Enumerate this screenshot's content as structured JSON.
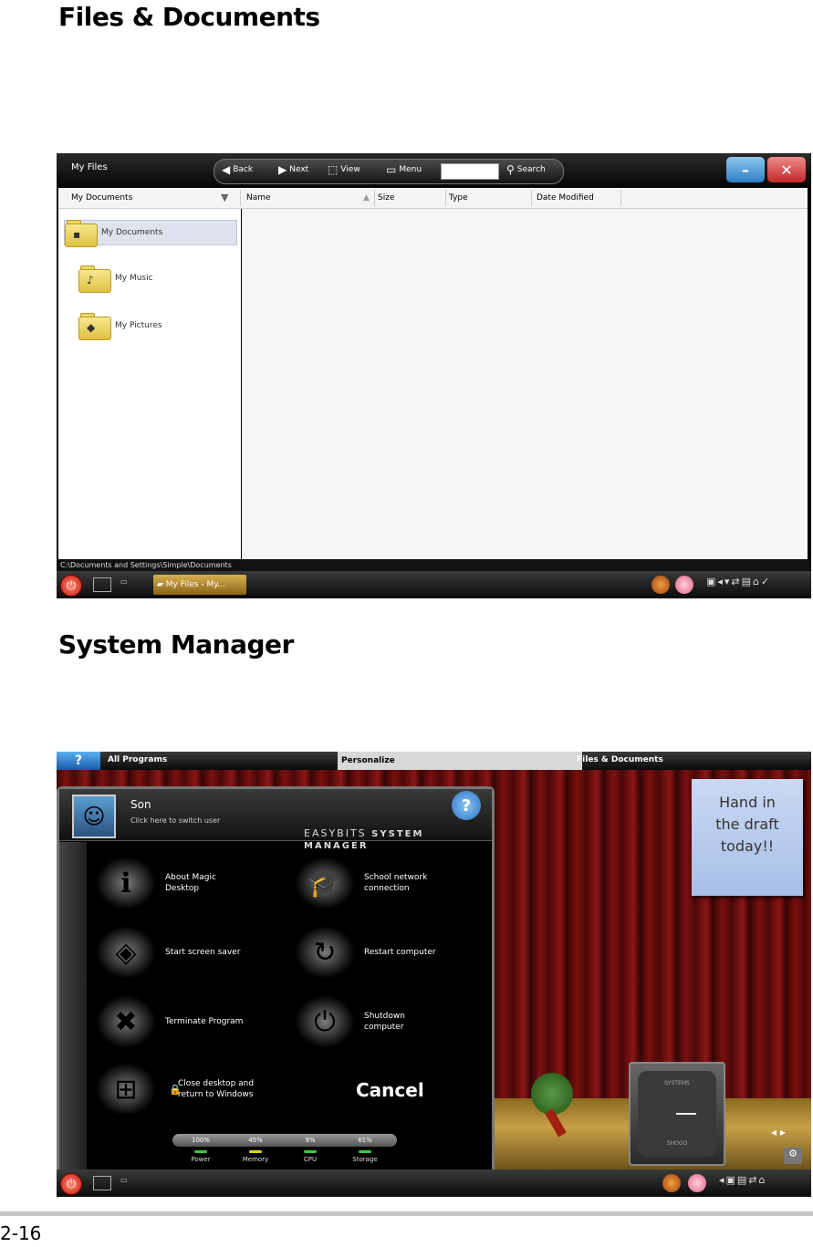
{
  "headings": {
    "files": "Files & Documents",
    "system": "System Manager"
  },
  "page_number": "2-16",
  "files_window": {
    "title": "My Files",
    "toolbar": {
      "back": "Back",
      "next": "Next",
      "view": "View",
      "menu": "Menu",
      "search": "Search",
      "search_value": ""
    },
    "window_buttons": {
      "minimize": "–",
      "close": "✕"
    },
    "location_dropdown": "My Documents",
    "columns": [
      "Name",
      "Size",
      "Type",
      "Date Modified"
    ],
    "folders": [
      {
        "label": "My Documents",
        "icon": "folder-documents-icon",
        "selected": true
      },
      {
        "label": "My Music",
        "icon": "folder-music-icon",
        "selected": false
      },
      {
        "label": "My Pictures",
        "icon": "folder-pictures-icon",
        "selected": false
      }
    ],
    "status": "C:\\Documents and Settings\\Simple\\Documents",
    "taskbar_item": "My Files - My..."
  },
  "system_manager": {
    "top_tabs": [
      "All Programs",
      "Personalize",
      "Files & Documents"
    ],
    "help_label": "?",
    "user": {
      "name": "Son",
      "hint": "Click here to switch user"
    },
    "brand": {
      "name": "EASYBITS",
      "product": "SYSTEM MANAGER"
    },
    "options": [
      {
        "label": "About Magic Desktop",
        "icon": "about-icon"
      },
      {
        "label": "School network connection",
        "icon": "graduation-cap-icon"
      },
      {
        "label": "Start screen saver",
        "icon": "screen-saver-icon"
      },
      {
        "label": "Restart computer",
        "icon": "restart-icon"
      },
      {
        "label": "Terminate Program",
        "icon": "terminate-program-icon"
      },
      {
        "label": "Shutdown computer",
        "icon": "shutdown-icon"
      },
      {
        "label": "Close desktop and return to Windows",
        "icon": "windows-icon"
      }
    ],
    "cancel": "Cancel",
    "stats": [
      {
        "label": "Power",
        "value": "100%",
        "color": "#3ac83a"
      },
      {
        "label": "Memory",
        "value": "45%",
        "color": "#e0d020"
      },
      {
        "label": "CPU",
        "value": "9%",
        "color": "#3ac83a"
      },
      {
        "label": "Storage",
        "value": "61%",
        "color": "#3ac83a"
      }
    ],
    "note_text": [
      "Hand in",
      "the draft",
      "today!!"
    ],
    "clock": {
      "top": "SYSTEMS",
      "bottom": "SHOGO"
    }
  }
}
